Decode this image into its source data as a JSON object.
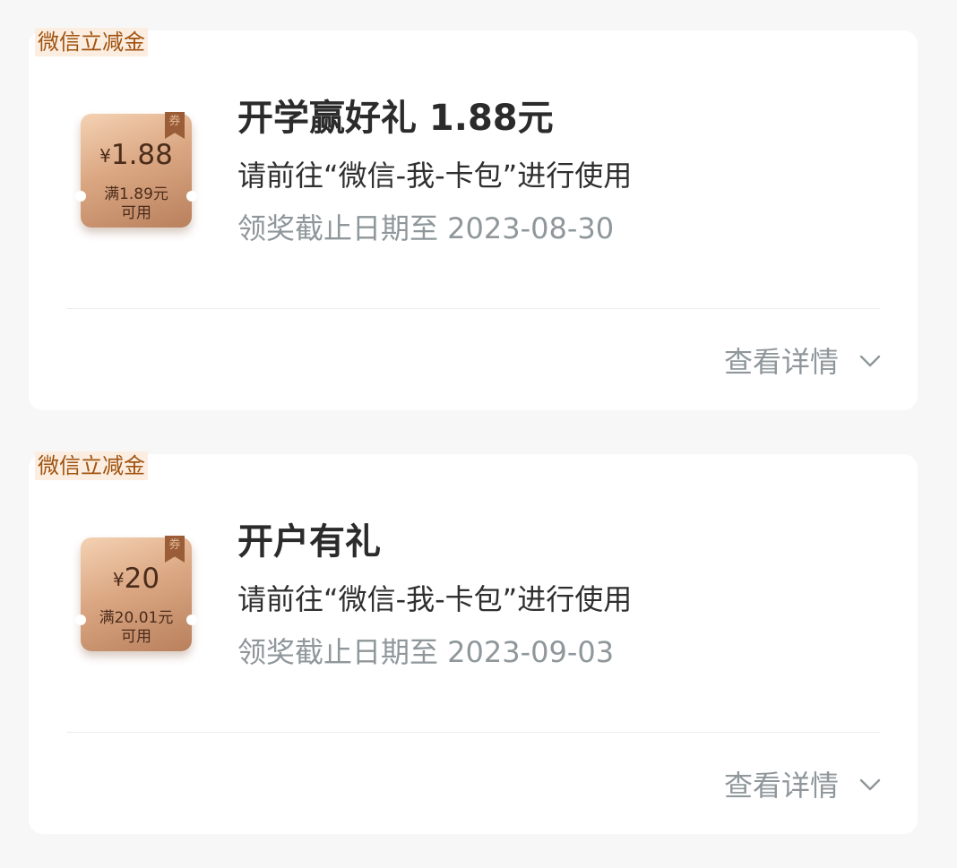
{
  "cards": [
    {
      "tag": "微信立减金",
      "coupon": {
        "currency": "¥",
        "amount": "1.88",
        "condition_line1": "满1.89元",
        "condition_line2": "可用",
        "ribbon": "券"
      },
      "title": "开学赢好礼 1.88元",
      "description": "请前往“微信-我-卡包”进行使用",
      "deadline": "领奖截止日期至 2023-08-30",
      "details_label": "查看详情",
      "details_icon": "chevron-down-icon"
    },
    {
      "tag": "微信立减金",
      "coupon": {
        "currency": "¥",
        "amount": "20",
        "condition_line1": "满20.01元",
        "condition_line2": "可用",
        "ribbon": "券"
      },
      "title": "开户有礼",
      "description": "请前往“微信-我-卡包”进行使用",
      "deadline": "领奖截止日期至 2023-09-03",
      "details_label": "查看详情",
      "details_icon": "chevron-down-icon"
    }
  ],
  "colors": {
    "tag_bg": "#fbeee1",
    "tag_text": "#a0520f",
    "coupon_light": "#f4d2b3",
    "coupon_dark": "#b9805d",
    "title": "#2b2b2b",
    "muted": "#8f979b"
  }
}
